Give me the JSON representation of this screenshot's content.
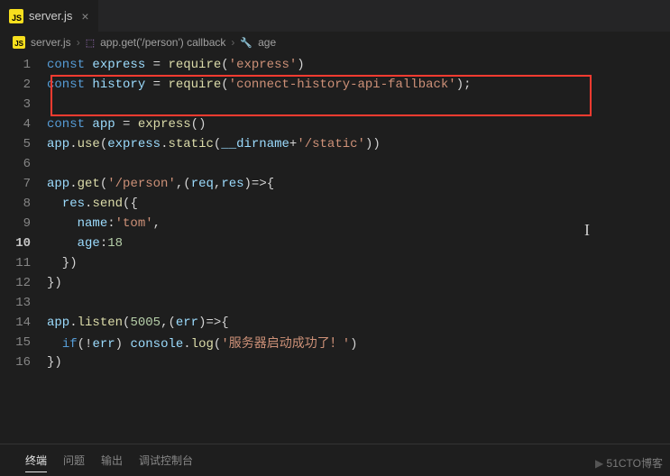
{
  "tab": {
    "filename": "server.js",
    "icon": "JS"
  },
  "breadcrumb": {
    "file_icon": "JS",
    "file": "server.js",
    "symbol1": "app.get('/person') callback",
    "symbol2": "age"
  },
  "code": {
    "lines": [
      {
        "n": 1,
        "tokens": [
          [
            "kw",
            "const"
          ],
          [
            "punc",
            " "
          ],
          [
            "var",
            "express"
          ],
          [
            "punc",
            " = "
          ],
          [
            "fn",
            "require"
          ],
          [
            "punc",
            "("
          ],
          [
            "str",
            "'express'"
          ],
          [
            "punc",
            ")"
          ]
        ]
      },
      {
        "n": 2,
        "tokens": [
          [
            "kw",
            "const"
          ],
          [
            "punc",
            " "
          ],
          [
            "var",
            "history"
          ],
          [
            "punc",
            " = "
          ],
          [
            "fn",
            "require"
          ],
          [
            "punc",
            "("
          ],
          [
            "str",
            "'connect-history-api-fallback'"
          ],
          [
            "punc",
            ");"
          ]
        ]
      },
      {
        "n": 3,
        "tokens": []
      },
      {
        "n": 4,
        "tokens": [
          [
            "kw",
            "const"
          ],
          [
            "punc",
            " "
          ],
          [
            "var",
            "app"
          ],
          [
            "punc",
            " = "
          ],
          [
            "fn",
            "express"
          ],
          [
            "punc",
            "()"
          ]
        ]
      },
      {
        "n": 5,
        "tokens": [
          [
            "var",
            "app"
          ],
          [
            "punc",
            "."
          ],
          [
            "fn",
            "use"
          ],
          [
            "punc",
            "("
          ],
          [
            "var",
            "express"
          ],
          [
            "punc",
            "."
          ],
          [
            "fn",
            "static"
          ],
          [
            "punc",
            "("
          ],
          [
            "var",
            "__dirname"
          ],
          [
            "punc",
            "+"
          ],
          [
            "str",
            "'/static'"
          ],
          [
            "punc",
            "))"
          ]
        ]
      },
      {
        "n": 6,
        "tokens": []
      },
      {
        "n": 7,
        "tokens": [
          [
            "var",
            "app"
          ],
          [
            "punc",
            "."
          ],
          [
            "fn",
            "get"
          ],
          [
            "punc",
            "("
          ],
          [
            "str",
            "'/person'"
          ],
          [
            "punc",
            ",("
          ],
          [
            "var",
            "req"
          ],
          [
            "punc",
            ","
          ],
          [
            "var",
            "res"
          ],
          [
            "punc",
            ")=>{"
          ]
        ]
      },
      {
        "n": 8,
        "tokens": [
          [
            "punc",
            "  "
          ],
          [
            "var",
            "res"
          ],
          [
            "punc",
            "."
          ],
          [
            "fn",
            "send"
          ],
          [
            "punc",
            "({"
          ]
        ]
      },
      {
        "n": 9,
        "tokens": [
          [
            "punc",
            "    "
          ],
          [
            "prop",
            "name"
          ],
          [
            "punc",
            ":"
          ],
          [
            "str",
            "'tom'"
          ],
          [
            "punc",
            ","
          ]
        ]
      },
      {
        "n": 10,
        "current": true,
        "tokens": [
          [
            "punc",
            "    "
          ],
          [
            "prop",
            "age"
          ],
          [
            "punc",
            ":"
          ],
          [
            "num",
            "18"
          ]
        ]
      },
      {
        "n": 11,
        "tokens": [
          [
            "punc",
            "  })"
          ]
        ]
      },
      {
        "n": 12,
        "tokens": [
          [
            "punc",
            "})"
          ]
        ]
      },
      {
        "n": 13,
        "tokens": []
      },
      {
        "n": 14,
        "tokens": [
          [
            "var",
            "app"
          ],
          [
            "punc",
            "."
          ],
          [
            "fn",
            "listen"
          ],
          [
            "punc",
            "("
          ],
          [
            "num",
            "5005"
          ],
          [
            "punc",
            ",("
          ],
          [
            "var",
            "err"
          ],
          [
            "punc",
            ")=>{"
          ]
        ]
      },
      {
        "n": 15,
        "tokens": [
          [
            "punc",
            "  "
          ],
          [
            "kw",
            "if"
          ],
          [
            "punc",
            "(!"
          ],
          [
            "var",
            "err"
          ],
          [
            "punc",
            ") "
          ],
          [
            "var",
            "console"
          ],
          [
            "punc",
            "."
          ],
          [
            "fn",
            "log"
          ],
          [
            "punc",
            "("
          ],
          [
            "str",
            "'服务器启动成功了！'"
          ],
          [
            "punc",
            ")"
          ]
        ]
      },
      {
        "n": 16,
        "tokens": [
          [
            "punc",
            "})"
          ]
        ]
      }
    ]
  },
  "panel": {
    "tabs": [
      "终端",
      "问题",
      "输出",
      "调试控制台"
    ],
    "active": 0
  },
  "watermark": "51CTO博客"
}
